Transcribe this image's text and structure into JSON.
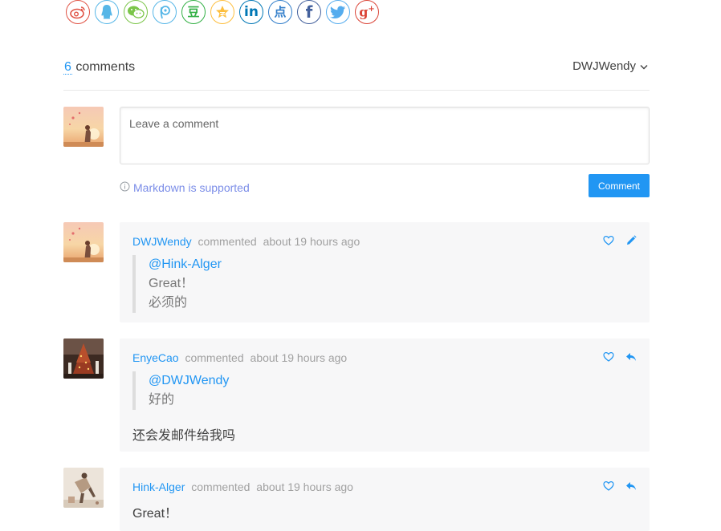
{
  "share": {
    "buttons": [
      {
        "name": "weibo",
        "icon": "weibo-icon"
      },
      {
        "name": "qq",
        "icon": "qq-icon"
      },
      {
        "name": "wechat",
        "icon": "wechat-icon"
      },
      {
        "name": "tencent-weibo",
        "icon": "tencent-weibo-icon"
      },
      {
        "name": "douban",
        "icon": "douban-icon",
        "glyph": "豆"
      },
      {
        "name": "qzone",
        "icon": "qzone-star-icon"
      },
      {
        "name": "linkedin",
        "icon": "linkedin-icon",
        "glyph": "in"
      },
      {
        "name": "diandian",
        "icon": "diandian-icon",
        "glyph": "点"
      },
      {
        "name": "facebook",
        "icon": "facebook-icon",
        "glyph": "f"
      },
      {
        "name": "twitter",
        "icon": "twitter-icon"
      },
      {
        "name": "google-plus",
        "icon": "google-plus-icon",
        "glyph": "g+"
      }
    ],
    "accent": "#2196f3"
  },
  "header": {
    "count": "6",
    "count_label": "comments",
    "user": "DWJWendy"
  },
  "editor": {
    "placeholder": "Leave a comment",
    "markdown_hint": "Markdown is supported",
    "submit_label": "Comment"
  },
  "comments": [
    {
      "author": "DWJWendy",
      "action": "commented",
      "time": "about 19 hours ago",
      "quote_mention": "@Hink-Alger",
      "quote_lines": [
        "Great！",
        "必须的"
      ],
      "body": "",
      "actions": [
        "heart-icon",
        "edit-icon"
      ]
    },
    {
      "author": "EnyeCao",
      "action": "commented",
      "time": "about 19 hours ago",
      "quote_mention": "@DWJWendy",
      "quote_lines": [
        "好的"
      ],
      "body": "还会发邮件给我吗",
      "actions": [
        "heart-icon",
        "reply-icon"
      ]
    },
    {
      "author": "Hink-Alger",
      "action": "commented",
      "time": "about 19 hours ago",
      "quote_mention": "",
      "quote_lines": [],
      "body": "Great！",
      "actions": [
        "heart-icon",
        "reply-icon"
      ]
    }
  ],
  "colors": {
    "link": "#2196f3",
    "card_bg": "#f7f7f8"
  }
}
